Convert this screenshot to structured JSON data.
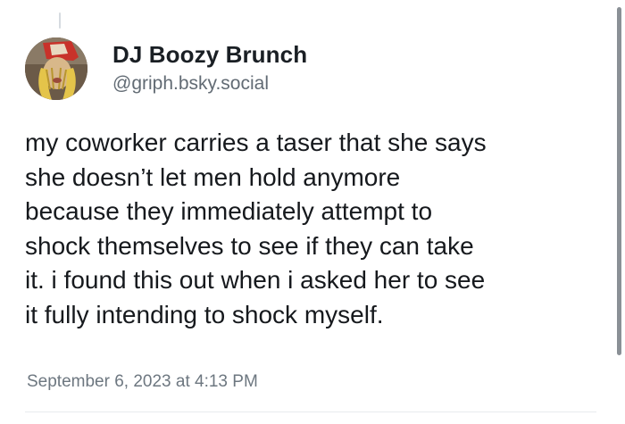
{
  "post": {
    "author": {
      "display_name": "DJ Boozy Brunch",
      "handle": "@griph.bsky.social",
      "avatar": "avatar-image"
    },
    "text": "my coworker carries a taser that she says\nshe doesn’t let men hold anymore\nbecause they immediately attempt to\nshock themselves to see if they can take\nit. i found this out when i asked her to see\nit fully intending to shock myself.",
    "timestamp": "September 6, 2023 at 4:13 PM"
  },
  "colors": {
    "name": "#1a1f24",
    "handle": "#626b74",
    "text": "#16191d",
    "timestamp": "#6d7780"
  }
}
